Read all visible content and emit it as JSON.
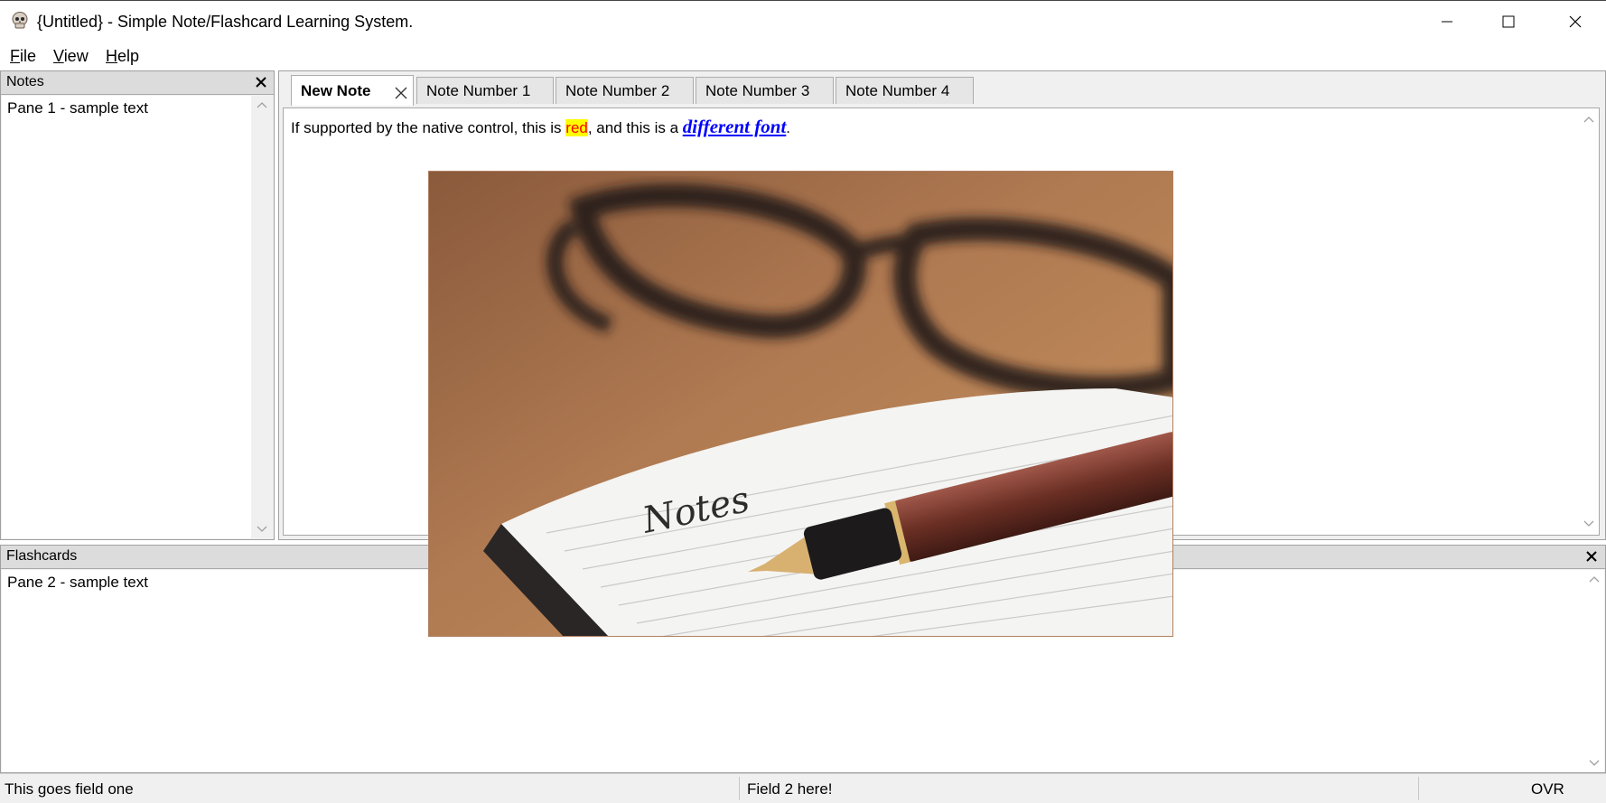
{
  "window": {
    "title": "{Untitled} - Simple Note/Flashcard Learning System.",
    "icon": "skull-icon"
  },
  "menu": {
    "items": [
      {
        "label": "File",
        "accel": "F",
        "rest": "ile"
      },
      {
        "label": "View",
        "accel": "V",
        "rest": "iew"
      },
      {
        "label": "Help",
        "accel": "H",
        "rest": "elp"
      }
    ]
  },
  "notes_pane": {
    "title": "Notes",
    "content": "Pane 1 - sample text"
  },
  "tabs": [
    {
      "label": "New Note",
      "active": true,
      "closable": true
    },
    {
      "label": "Note Number 1"
    },
    {
      "label": "Note Number 2"
    },
    {
      "label": "Note Number 3"
    },
    {
      "label": "Note Number 4"
    }
  ],
  "editor": {
    "text_before": "If supported by the native control, this is ",
    "red_word": "red",
    "text_middle": ", and this is a ",
    "font_word": "different font",
    "text_after": ".",
    "image_caption": "Notes"
  },
  "flashcards_pane": {
    "title": "Flashcards",
    "content": "Pane 2 - sample text"
  },
  "status": {
    "field1": "This goes field one",
    "field2": "Field 2 here!",
    "field3": "OVR"
  },
  "colors": {
    "red_text": "#ff0000",
    "highlight": "#ffff00",
    "link_blue": "#0000ff"
  }
}
